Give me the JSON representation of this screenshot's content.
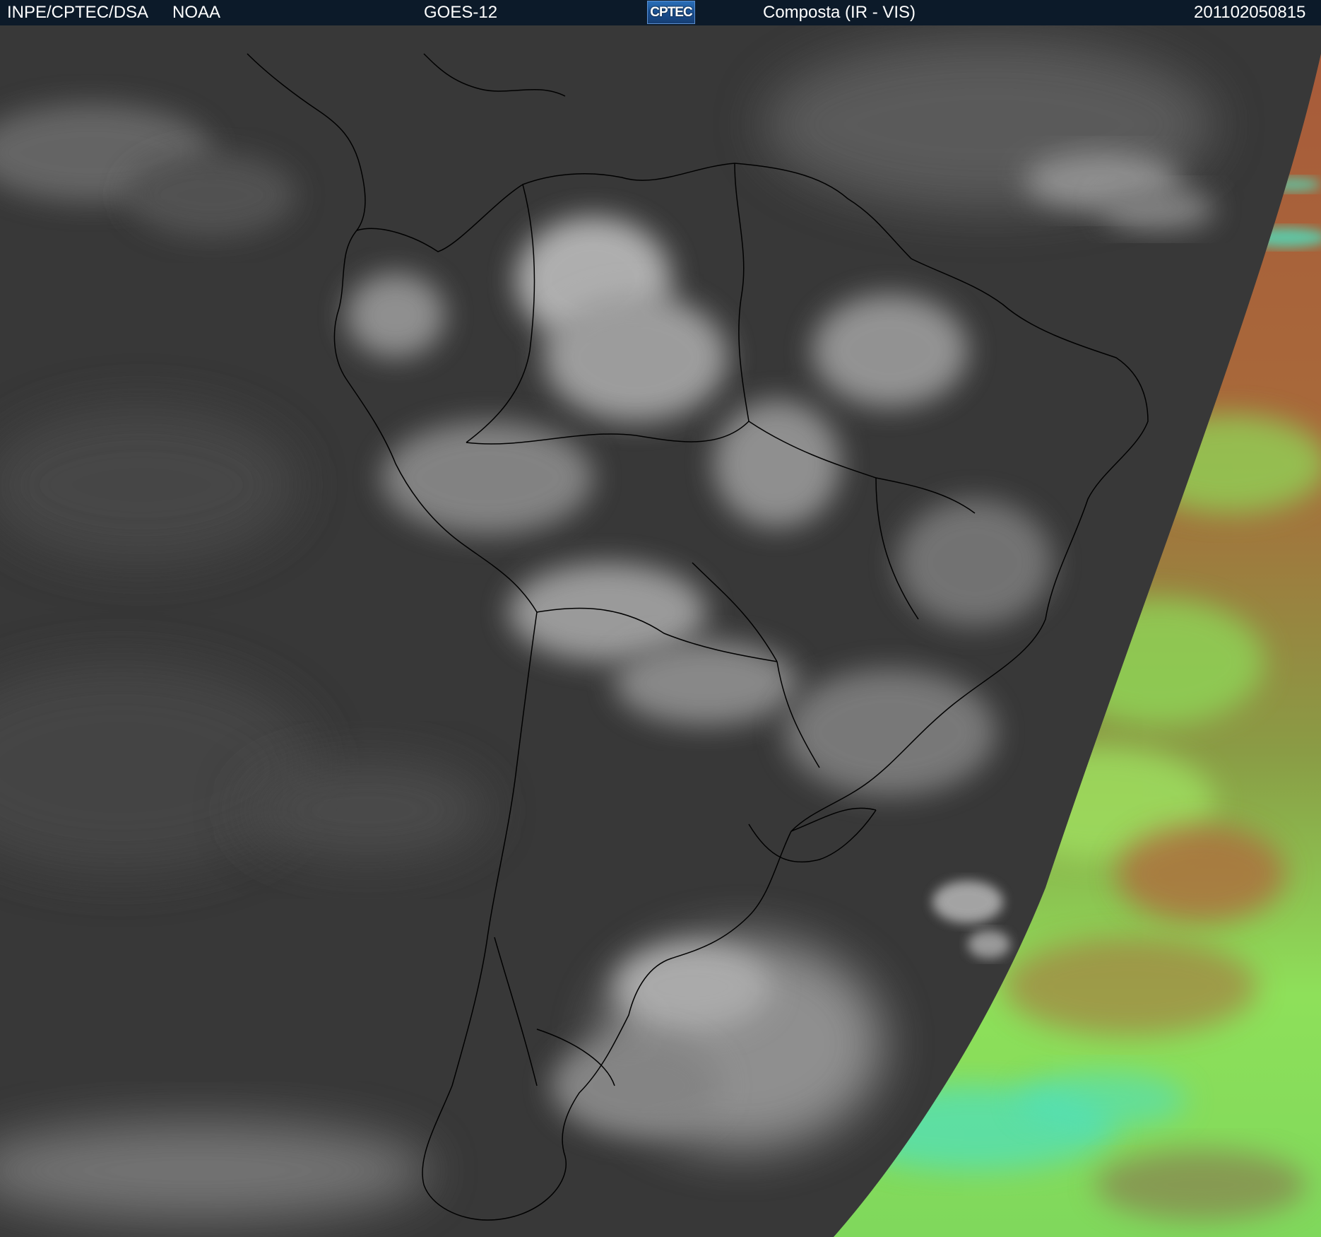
{
  "header": {
    "agency": "INPE/CPTEC/DSA",
    "source": "NOAA",
    "satellite": "GOES-12",
    "logo_text": "CPTEC",
    "product": "Composta (IR - VIS)",
    "timestamp": "201102050815"
  },
  "colors": {
    "header_bg": "#0c1a29",
    "ir_background": "#3a3a3a",
    "cloud": "#d8d8d8",
    "coastline": "#000000",
    "vis_red": "#b3623a",
    "vis_green": "#8ee05a",
    "vis_cyan": "#4ee0c0"
  }
}
